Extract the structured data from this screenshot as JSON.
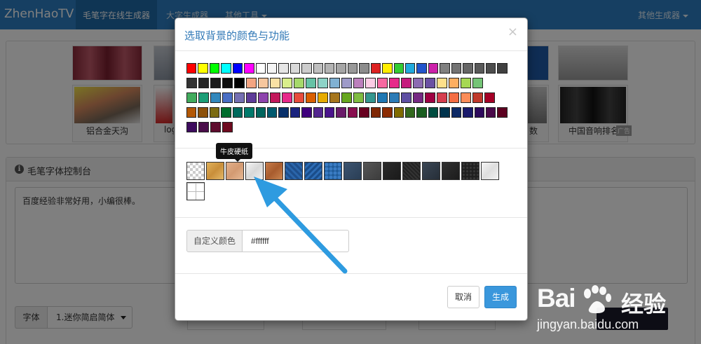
{
  "navbar": {
    "brand": "ZhenHaoTV",
    "items": [
      {
        "label": "毛笔字在线生成器"
      },
      {
        "label": "大字生成器"
      },
      {
        "label": "其他工具"
      }
    ],
    "right_menu": "其他生成器"
  },
  "ads": {
    "captions": [
      "铝合金天沟",
      "logo",
      "数",
      "中国音响排名"
    ],
    "ad_tag": "广告"
  },
  "control_panel": {
    "title": "毛笔字体控制台",
    "text_value": "百度经验非常好用，小编很棒。",
    "font_label": "字体",
    "font_value": "1.迷你简启简体"
  },
  "modal": {
    "title": "选取背景的颜色与功能",
    "close": "×",
    "colors": [
      [
        "#ff0000",
        "#ffff00",
        "#00ff00",
        "#00ffff",
        "#0000ff",
        "#ff00ff",
        "#ffffff",
        "#f4f4f4",
        "#e6e6e6",
        "#d9d9d9",
        "#cccccc",
        "#bfbfbf",
        "#b3b3b3",
        "#a6a6a6",
        "#999999",
        "#8c8c8c",
        "#dd2222",
        "#ffee00",
        "#33cc33",
        "#22aadd",
        "#2255cc",
        "#cc22aa",
        "#808080",
        "#737373",
        "#666666",
        "#595959",
        "#4d4d4d",
        "#404040"
      ],
      [
        "#333333",
        "#262626",
        "#1a1a1a",
        "#0d0d0d",
        "#000000",
        "#f4a582",
        "#f7c79e",
        "#f9e1a4",
        "#d9ef8b",
        "#a6d96a",
        "#66c2a5",
        "#8dd3c7",
        "#80b1d3",
        "#9e9ac8",
        "#bc80bd",
        "#fccde5",
        "#f768a1",
        "#e7298a",
        "#c51b7d",
        "#8c6bb1",
        "#6a51a3",
        "#fee08b",
        "#fdae61",
        "#a6d854",
        "#74c476"
      ],
      [
        "#41ab5d",
        "#1b9e77",
        "#3288bd",
        "#4a6fc5",
        "#7570b3",
        "#5e3c99",
        "#8e44ad",
        "#c2185b",
        "#e7298a",
        "#e74c3c",
        "#d95f02",
        "#e6ab02",
        "#a6761d",
        "#66a61e",
        "#7fbc41",
        "#35978f",
        "#1f78b4",
        "#2c7bb6",
        "#5e4fa2",
        "#762a83",
        "#9e0142",
        "#d53e4f",
        "#f46d43",
        "#fc8d59",
        "#c0392b",
        "#a50026"
      ],
      [
        "#b35806",
        "#8c510a",
        "#7b6b12",
        "#006d2c",
        "#00695c",
        "#00796b",
        "#01665e",
        "#005a6e",
        "#08306b",
        "#1a237e",
        "#3f007d",
        "#54278f",
        "#4a148c",
        "#6a1b6a",
        "#880e4f",
        "#67001f",
        "#7f2704",
        "#8c2d04",
        "#806b00",
        "#33691e",
        "#1b5e20",
        "#004d40",
        "#00334d",
        "#0d2a66",
        "#1a1a6b",
        "#2d0a5c",
        "#4a0a4a",
        "#5c0020"
      ],
      [
        "#3d0b5e",
        "#4a0d4a",
        "#5e0c2e",
        "#6e0a1f"
      ]
    ],
    "textures": [
      [
        "transparent",
        "wood-light",
        "kraft-paper",
        "white-paper",
        "brown-leather",
        "blue-pattern-1",
        "blue-pattern-2",
        "blue-pattern-3",
        "slate-1",
        "slate-2",
        "dark-1",
        "dark-2",
        "dark-3",
        "dark-4",
        "dark-5",
        "white-marble"
      ],
      [
        "grid"
      ]
    ],
    "tooltip": "牛皮硬纸",
    "custom_label": "自定义颜色",
    "custom_value": "#ffffff",
    "cancel_label": "取消",
    "generate_label": "生成"
  },
  "watermark": {
    "logo_left": "Bai",
    "logo_right": "经验",
    "url": "jingyan.baidu.com"
  }
}
